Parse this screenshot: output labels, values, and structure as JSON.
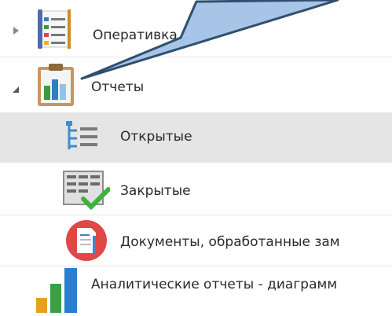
{
  "tree": {
    "items": [
      {
        "label": "Оперативка",
        "icon": "task-list-icon",
        "expander": "collapsed"
      },
      {
        "label": "Отчеты",
        "icon": "clipboard-chart-icon",
        "expander": "expanded"
      },
      {
        "label": "Открытые",
        "icon": "open-reports-icon",
        "selected": true
      },
      {
        "label": "Закрытые",
        "icon": "closed-reports-checkmark-icon"
      },
      {
        "label": "Документы, обработанные зам",
        "icon": "document-red-circle-icon"
      },
      {
        "label": "Аналитические отчеты - диаграмм",
        "icon": "bar-chart-icon"
      }
    ]
  },
  "colors": {
    "selection": "#e5e5e5",
    "callout_fill": "#a8c4e6",
    "callout_stroke": "#2f4f6f"
  }
}
